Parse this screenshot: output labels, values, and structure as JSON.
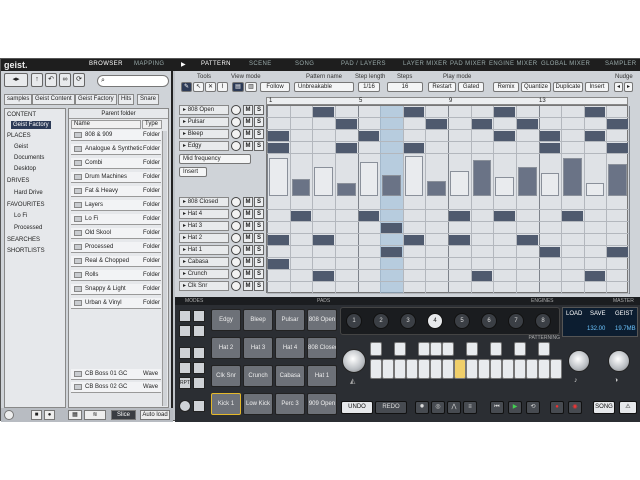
{
  "app": {
    "logo": "geist."
  },
  "main_tabs": [
    "BROWSER",
    "MAPPING"
  ],
  "pattern_tabs": [
    "PATTERN",
    "SCENE",
    "SONG",
    "PAD / LAYERS",
    "LAYER MIXER",
    "PAD MIXER",
    "ENGINE MIXER",
    "GLOBAL MIXER",
    "SAMPLER"
  ],
  "browser": {
    "breadcrumbs": [
      "samples",
      "Geist Content",
      "Geist Factory",
      "Hits",
      "Snare"
    ],
    "tree": {
      "content_header": "CONTENT",
      "content_items": [
        "Geist Factory"
      ],
      "places_header": "PLACES",
      "places_items": [
        "Geist",
        "Documents",
        "Desktop"
      ],
      "drives_header": "DRIVES",
      "drives_items": [
        "Hard Drive"
      ],
      "favourites_header": "FAVOURITES",
      "favourites_items": [
        "Lo Fi",
        "Processed"
      ],
      "searches": "SEARCHES",
      "shortlists": "SHORTLISTS"
    },
    "parent_folder": "Parent folder",
    "col_name": "Name",
    "col_type": "Type",
    "folders": [
      {
        "name": "808 & 909",
        "type": "Folder"
      },
      {
        "name": "Analogue & Synthetic",
        "type": "Folder"
      },
      {
        "name": "Combi",
        "type": "Folder"
      },
      {
        "name": "Drum Machines",
        "type": "Folder"
      },
      {
        "name": "Fat & Heavy",
        "type": "Folder"
      },
      {
        "name": "Layers",
        "type": "Folder"
      },
      {
        "name": "Lo Fi",
        "type": "Folder"
      },
      {
        "name": "Old Skool",
        "type": "Folder"
      },
      {
        "name": "Processed",
        "type": "Folder"
      },
      {
        "name": "Real & Chopped",
        "type": "Folder"
      },
      {
        "name": "Rolls",
        "type": "Folder"
      },
      {
        "name": "Snappy & Light",
        "type": "Folder"
      },
      {
        "name": "Urban & Vinyl",
        "type": "Folder"
      }
    ],
    "files": [
      {
        "name": "CB Boss 01 GC",
        "type": "Wave"
      },
      {
        "name": "CB Boss 02 GC",
        "type": "Wave"
      }
    ],
    "slice_label": "Slice",
    "autoload_label": "Auto load"
  },
  "pattern": {
    "tools_label": "Tools",
    "view_mode_label": "View mode",
    "follow_label": "Follow",
    "pattern_name_label": "Pattern name",
    "pattern_name": "Unbreakable",
    "step_length_label": "Step length",
    "step_length": "1/16",
    "steps_label": "Steps",
    "steps": "16",
    "play_mode_label": "Play mode",
    "restart_label": "Restart",
    "gated_label": "Gated",
    "remix_label": "Remix",
    "quantize_label": "Quantize",
    "duplicate_label": "Duplicate",
    "insert_label": "Insert",
    "nudge_label": "Nudge",
    "ruler": [
      "1",
      "5",
      "9",
      "13"
    ],
    "mid_frequency": "Mid frequency",
    "insert_dd": "Insert",
    "tracks": [
      "808 Open",
      "Pulsar",
      "Bleep",
      "Edgy",
      "808 Closed",
      "Hat 4",
      "Hat 3",
      "Hat 2",
      "Hat 1",
      "Cabasa",
      "Crunch",
      "Clk Snr"
    ]
  },
  "pads": {
    "modes_label": "MODES",
    "pads_label": "PADS",
    "engines_label": "ENGINES",
    "master_label": "MASTER",
    "patterning_label": "PATTERNING",
    "rpt_label": "RPT",
    "items": [
      "Edgy",
      "Bleep",
      "Pulsar",
      "808 Open",
      "Hat 2",
      "Hat 3",
      "Hat 4",
      "808 Closed",
      "Clk Snr",
      "Crunch",
      "Cabasa",
      "Hat 1",
      "Kick 1",
      "Low Kick",
      "Perc 3",
      "909 Open"
    ],
    "engines": [
      "1",
      "2",
      "3",
      "4",
      "5",
      "6",
      "7",
      "8"
    ],
    "load_label": "LOAD",
    "save_label": "SAVE",
    "geist_label": "GEIST",
    "bpm": "132.00",
    "memory": "19.7MB",
    "undo_label": "UNDO",
    "redo_label": "REDO",
    "song_label": "SONG"
  }
}
